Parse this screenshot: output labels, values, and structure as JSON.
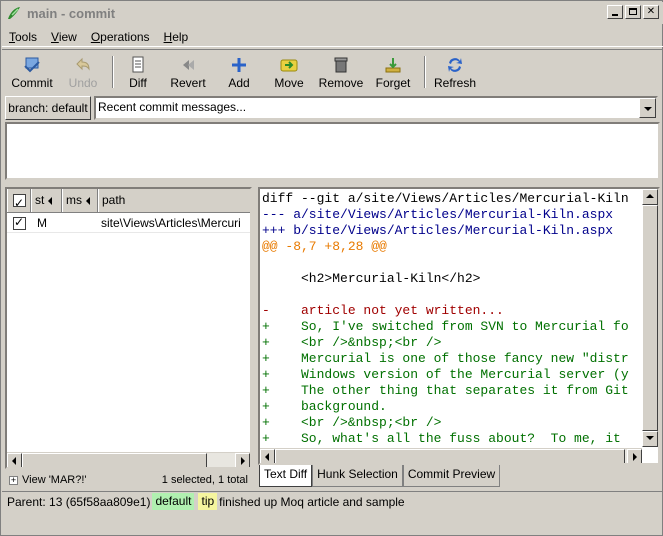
{
  "window": {
    "title": "main - commit",
    "buttons": [
      "_",
      "□",
      "X"
    ]
  },
  "menu": [
    {
      "label": "Tools",
      "mnemonic": "T",
      "rest": "ools"
    },
    {
      "label": "View",
      "mnemonic": "V",
      "rest": "iew"
    },
    {
      "label": "Operations",
      "mnemonic": "O",
      "rest": "perations"
    },
    {
      "label": "Help",
      "mnemonic": "H",
      "rest": "elp"
    }
  ],
  "toolbar": {
    "commit": "Commit",
    "undo": "Undo",
    "diff": "Diff",
    "revert": "Revert",
    "add": "Add",
    "move": "Move",
    "remove": "Remove",
    "forget": "Forget",
    "refresh": "Refresh"
  },
  "branch_label": "branch: default",
  "commit_combo": {
    "value": "Recent commit messages..."
  },
  "commit_message": "",
  "filelist": {
    "headers": {
      "st": "st",
      "ms": "ms",
      "path": "path"
    },
    "rows": [
      {
        "checked": true,
        "status": "M",
        "ms": "",
        "path": "site\\Views\\Articles\\Mercuri"
      }
    ],
    "footer_view": "View 'MAR?!'",
    "footer_count": "1 selected, 1 total"
  },
  "diff": {
    "lines": [
      {
        "type": "meta",
        "text": "diff --git a/site/Views/Articles/Mercurial-Kiln"
      },
      {
        "type": "file",
        "text": "--- a/site/Views/Articles/Mercurial-Kiln.aspx"
      },
      {
        "type": "file",
        "text": "+++ b/site/Views/Articles/Mercurial-Kiln.aspx"
      },
      {
        "type": "hunk",
        "text": "@@ -8,7 +8,28 @@"
      },
      {
        "type": "ctx",
        "text": " "
      },
      {
        "type": "ctx",
        "text": "     <h2>Mercurial-Kiln</h2>"
      },
      {
        "type": "ctx",
        "text": " "
      },
      {
        "type": "del",
        "text": "-    article not yet written..."
      },
      {
        "type": "add",
        "text": "+    So, I've switched from SVN to Mercurial fo"
      },
      {
        "type": "add",
        "text": "+    <br />&nbsp;<br />"
      },
      {
        "type": "add",
        "text": "+    Mercurial is one of those fancy new \"distr"
      },
      {
        "type": "add",
        "text": "+    Windows version of the Mercurial server (y"
      },
      {
        "type": "add",
        "text": "+    The other thing that separates it from Git"
      },
      {
        "type": "add",
        "text": "+    background."
      },
      {
        "type": "add",
        "text": "+    <br />&nbsp;<br />"
      },
      {
        "type": "add",
        "text": "+    So, what's all the fuss about?  To me, it "
      }
    ]
  },
  "tabs": [
    "Text Diff",
    "Hunk Selection",
    "Commit Preview"
  ],
  "status": {
    "parent": "Parent: 13 (65f58aa809e1)",
    "branch_tag": "default",
    "tip_tag": "tip",
    "message": "finished up Moq article and sample"
  },
  "colors": {
    "hunk": "#e87a00",
    "added": "#007000",
    "removed": "#a00000",
    "file_header": "#00008b",
    "default_tag": "#b0f0b0",
    "tip_tag": "#f5f59e"
  }
}
